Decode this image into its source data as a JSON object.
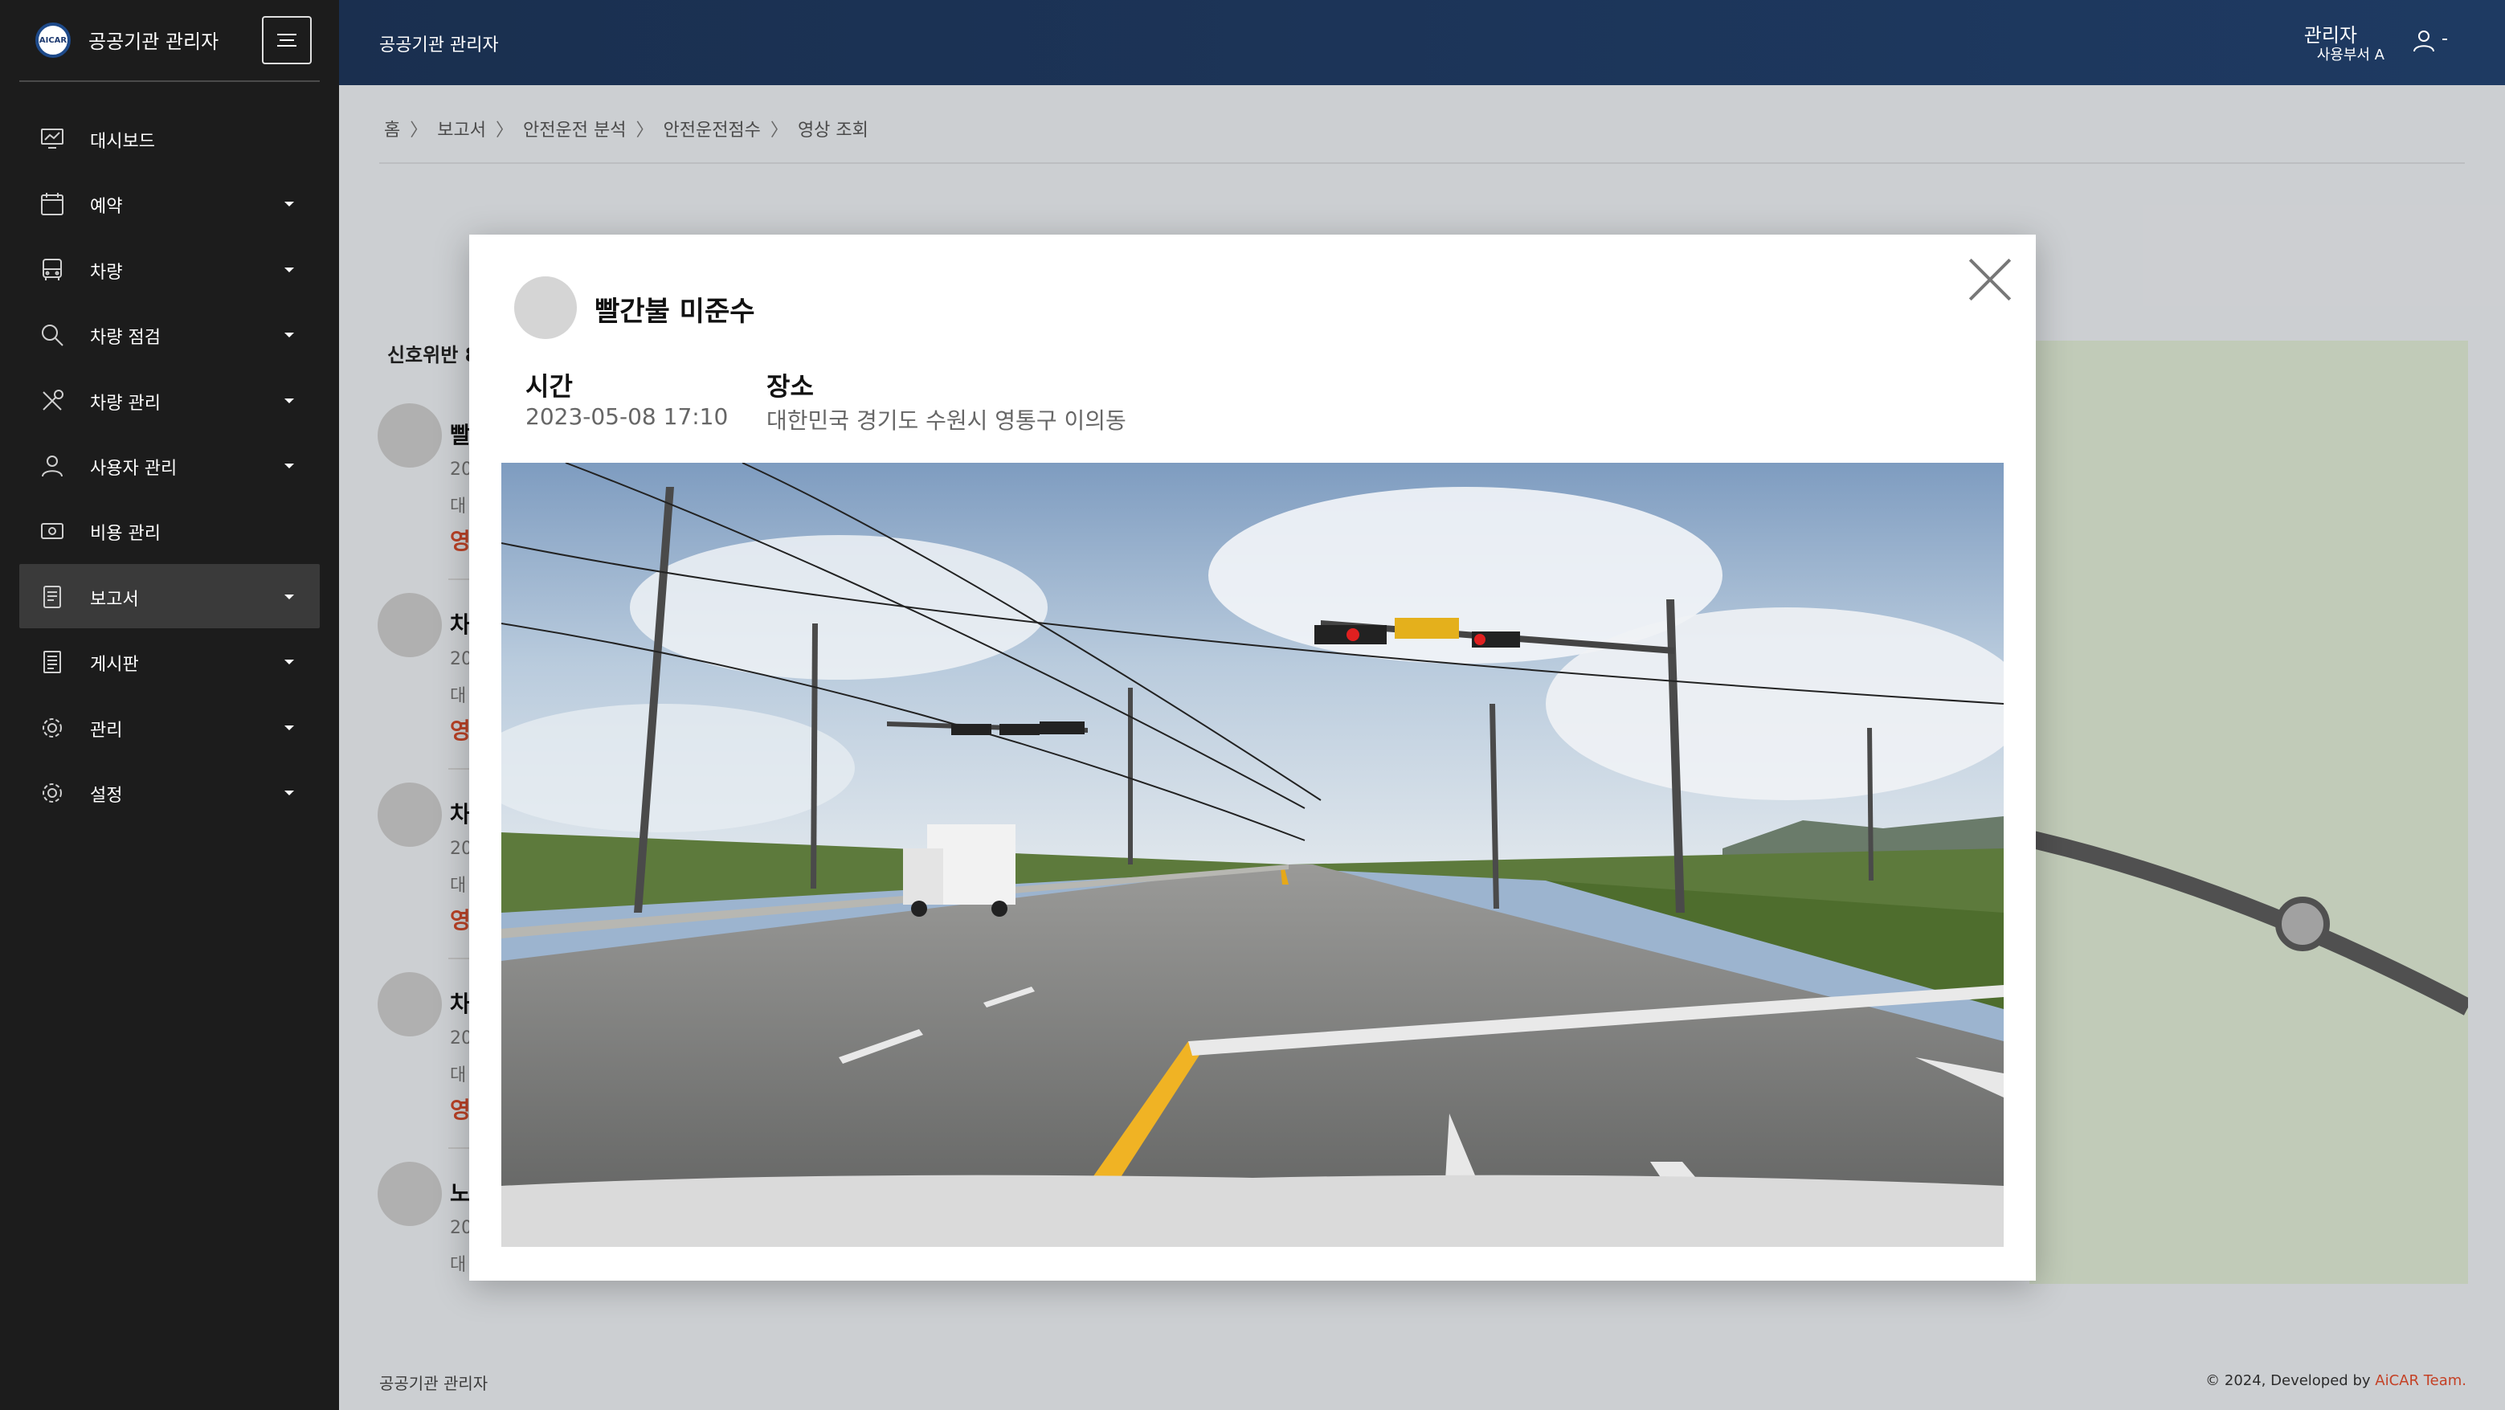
{
  "app": {
    "brand_logo_text": "AICAR",
    "brand_title": "공공기관 관리자",
    "topbar_title": "공공기관 관리자"
  },
  "user": {
    "name": "관리자",
    "department": "사용부서 A",
    "icon": "user-icon"
  },
  "sidebar": {
    "items": [
      {
        "label": "대시보드",
        "icon": "dashboard-icon",
        "has_caret": false
      },
      {
        "label": "예약",
        "icon": "calendar-icon",
        "has_caret": true
      },
      {
        "label": "차량",
        "icon": "bus-icon",
        "has_caret": true
      },
      {
        "label": "차량 점검",
        "icon": "search-icon",
        "has_caret": true
      },
      {
        "label": "차량 관리",
        "icon": "wrench-icon",
        "has_caret": true
      },
      {
        "label": "사용자 관리",
        "icon": "user-icon",
        "has_caret": true
      },
      {
        "label": "비용 관리",
        "icon": "money-icon",
        "has_caret": false
      },
      {
        "label": "보고서",
        "icon": "report-icon",
        "has_caret": true,
        "active": true
      },
      {
        "label": "게시판",
        "icon": "board-icon",
        "has_caret": true
      },
      {
        "label": "관리",
        "icon": "gear-icon",
        "has_caret": true
      },
      {
        "label": "설정",
        "icon": "settings-icon",
        "has_caret": true
      }
    ]
  },
  "breadcrumb": [
    "홈",
    "보고서",
    "안전운전 분석",
    "안전운전점수",
    "영상 조회"
  ],
  "background_list": {
    "section_label": "신호위반 8",
    "items": [
      {
        "title": "빨",
        "date": "20",
        "addr": "대",
        "link": "영"
      },
      {
        "title": "차",
        "date": "20",
        "addr": "대",
        "link": "영"
      },
      {
        "title": "차",
        "date": "20",
        "addr": "대",
        "link": "영"
      },
      {
        "title": "차",
        "date": "20",
        "addr": "대",
        "link": "영"
      },
      {
        "title": "노",
        "date": "20",
        "addr": "대",
        "link": ""
      }
    ]
  },
  "modal": {
    "title": "빨간불 미준수",
    "time_label": "시간",
    "time_value": "2023-05-08 17:10",
    "place_label": "장소",
    "place_value": "대한민국 경기도 수원시 영통구 이의동"
  },
  "footer": {
    "left": "공공기관 관리자",
    "right_prefix": "© 2024, Developed by ",
    "right_brand": "AiCAR Team."
  },
  "colors": {
    "sidebar_bg": "#1c1c1c",
    "topbar_bg": "#1e3a62",
    "accent_red": "#d24b2c",
    "map_bg": "#dce7d2"
  }
}
